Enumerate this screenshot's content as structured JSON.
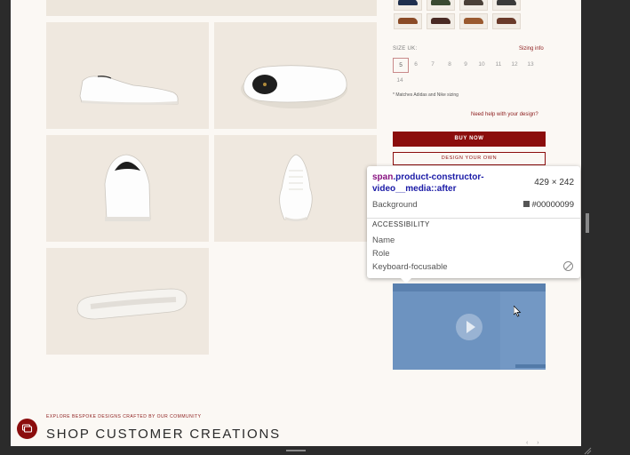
{
  "swatches_count": 8,
  "size_label": "SIZE UK:",
  "sizing_info": "Sizing info",
  "sizes": [
    "5",
    "6",
    "7",
    "8",
    "9",
    "10",
    "11",
    "12",
    "13",
    "14"
  ],
  "selected_size": "5",
  "note": "* Matches Adidas and Nike sizing",
  "help_link": "Need help with your design?",
  "buy_now": "BUY NOW",
  "design_your_own": "DESIGN YOUR OWN",
  "explore": "EXPLORE BESPOKE DESIGNS CRAFTED BY OUR COMMUNITY",
  "shop_title": "SHOP CUSTOMER CREATIONS",
  "carousel_arrows": "‹ ›",
  "tooltip": {
    "selector_tag": "span",
    "selector_class": ".product-constructor-video__media::after",
    "dimensions": "429 × 242",
    "background_label": "Background",
    "background_value": "#00000099",
    "accessibility_heading": "ACCESSIBILITY",
    "name_label": "Name",
    "role_label": "Role",
    "keyboard_label": "Keyboard-focusable"
  },
  "colors": {
    "brand": "#8b0d0d",
    "page_bg": "#fbf8f4",
    "video_overlay": "#6d93c0"
  }
}
